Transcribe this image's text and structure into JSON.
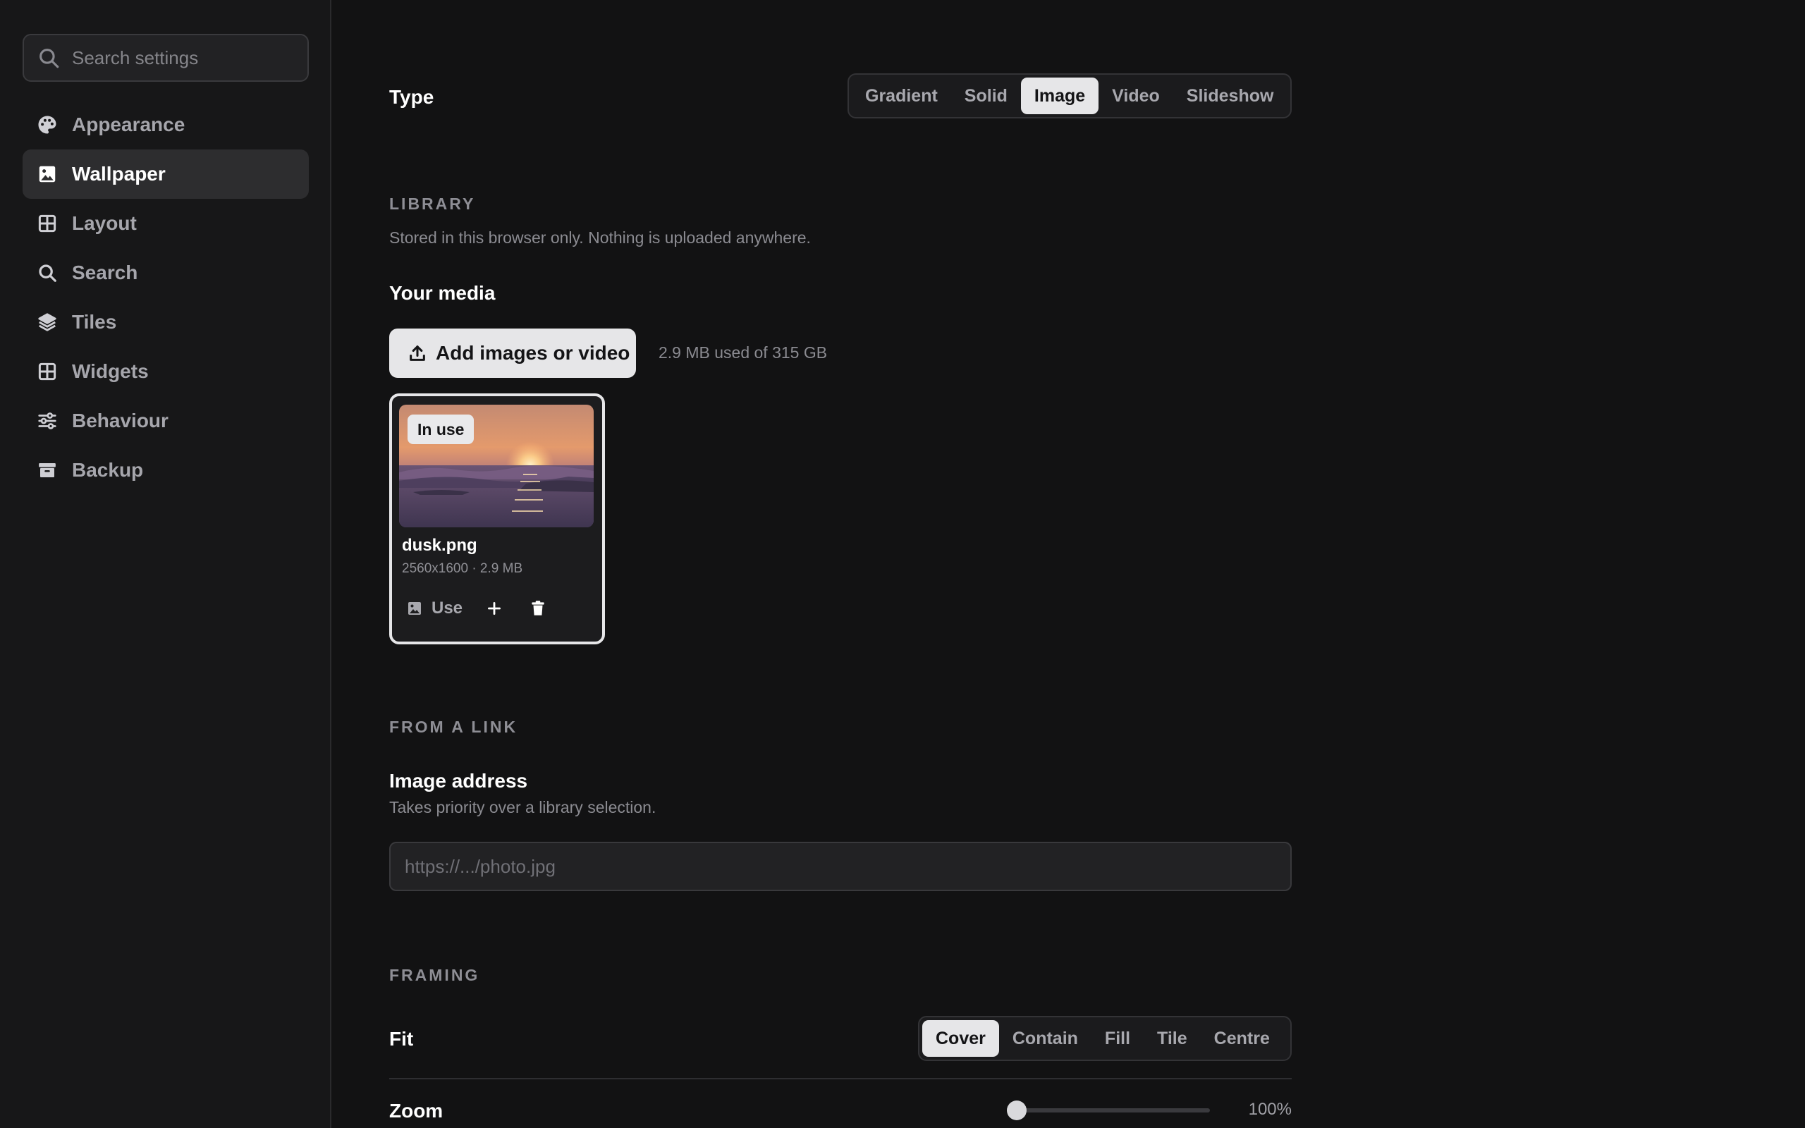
{
  "search": {
    "placeholder": "Search settings"
  },
  "sidebar": {
    "items": [
      {
        "label": "Appearance",
        "icon": "palette-icon"
      },
      {
        "label": "Wallpaper",
        "icon": "image-icon"
      },
      {
        "label": "Layout",
        "icon": "grid-icon"
      },
      {
        "label": "Search",
        "icon": "search-icon"
      },
      {
        "label": "Tiles",
        "icon": "layers-icon"
      },
      {
        "label": "Widgets",
        "icon": "widgets-icon"
      },
      {
        "label": "Behaviour",
        "icon": "sliders-icon"
      },
      {
        "label": "Backup",
        "icon": "archive-icon"
      }
    ],
    "active": "Wallpaper"
  },
  "type_row": {
    "label": "Type",
    "options": [
      "Gradient",
      "Solid",
      "Image",
      "Video",
      "Slideshow"
    ],
    "selected": "Image"
  },
  "library": {
    "title": "LIBRARY",
    "description": "Stored in this browser only. Nothing is uploaded anywhere.",
    "media_heading": "Your media",
    "add_button": "Add images or video",
    "storage_text": "2.9 MB used of 315 GB",
    "items": [
      {
        "badge": "In use",
        "name": "dusk.png",
        "meta": "2560x1600 · 2.9 MB",
        "use_label": "Use"
      }
    ]
  },
  "link": {
    "title": "FROM A LINK",
    "heading": "Image address",
    "description": "Takes priority over a library selection.",
    "placeholder": "https://.../photo.jpg"
  },
  "framing": {
    "title": "FRAMING",
    "fit_label": "Fit",
    "fit_options": [
      "Cover",
      "Contain",
      "Fill",
      "Tile",
      "Centre"
    ],
    "fit_selected": "Cover",
    "zoom_label": "Zoom",
    "zoom_value": "100%",
    "zoom_percent": 100
  },
  "colors": {
    "background": "#121213",
    "sidebar": "#171718",
    "accent": "#e6e6e8"
  }
}
